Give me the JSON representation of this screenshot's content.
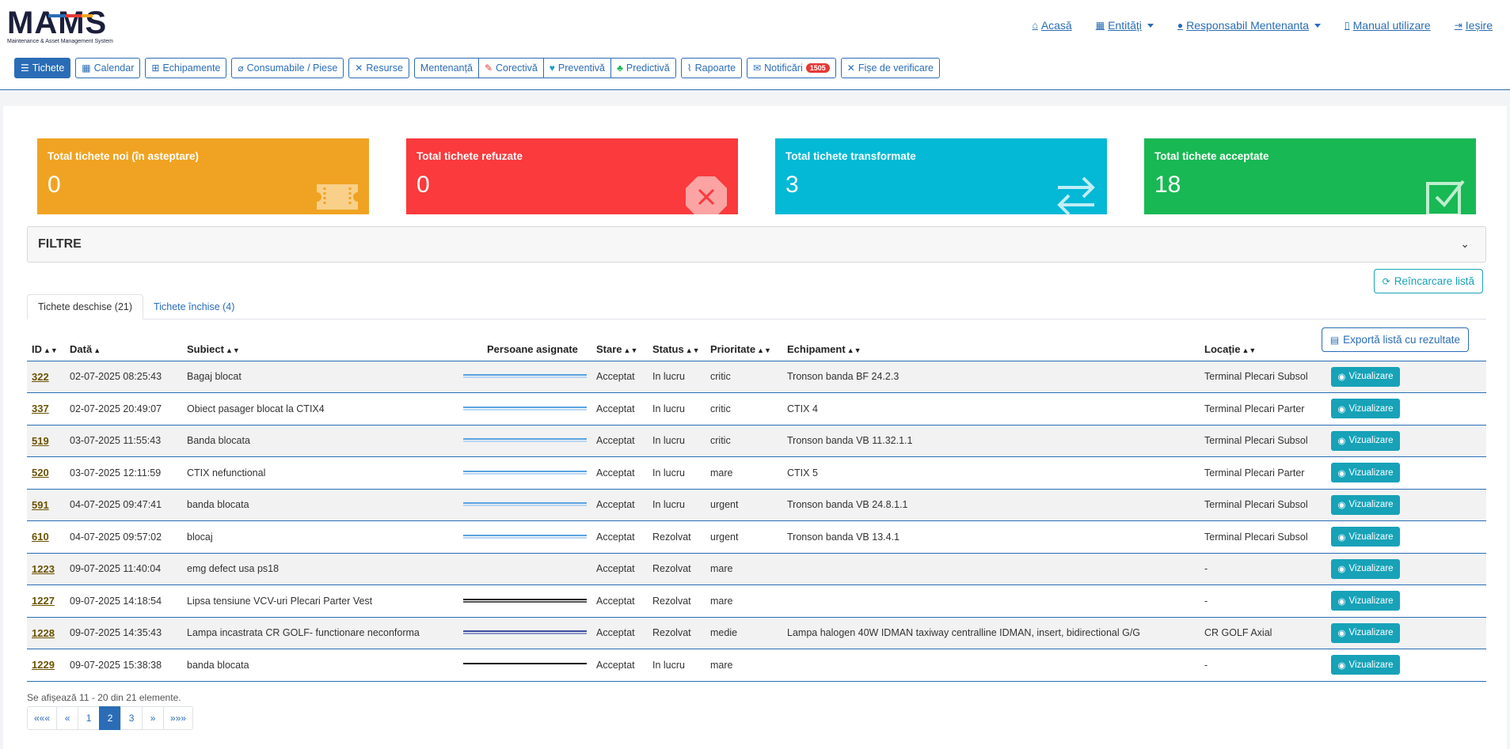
{
  "app": {
    "logo_text": "MAMS",
    "logo_subtitle": "Maintenance & Asset Management System"
  },
  "topnav": [
    {
      "label": "Acasă",
      "icon": "home-icon"
    },
    {
      "label": "Entități",
      "icon": "table-icon",
      "dropdown": true
    },
    {
      "label": "Responsabil Mentenanta",
      "icon": "user-icon",
      "dropdown": true
    },
    {
      "label": "Manual utilizare",
      "icon": "book-icon"
    },
    {
      "label": "Ieșire",
      "icon": "logout-icon"
    }
  ],
  "menu": {
    "tichete": "Tichete",
    "calendar": "Calendar",
    "echipamente": "Echipamente",
    "consumabile": "Consumabile / Piese",
    "resurse": "Resurse",
    "mentenanta": "Mentenanță",
    "corectiva": "Corectivă",
    "preventiva": "Preventivă",
    "predictiva": "Predictivă",
    "rapoarte": "Rapoarte",
    "notificari": "Notificări",
    "notificari_count": "1505",
    "fise": "Fișe de verificare"
  },
  "cards": [
    {
      "title": "Total tichete noi (în asteptare)",
      "value": "0",
      "color": "#f0a322",
      "icon": "ticket-icon"
    },
    {
      "title": "Total tichete refuzate",
      "value": "0",
      "color": "#fa3a3d",
      "icon": "refused-icon"
    },
    {
      "title": "Total tichete transformate",
      "value": "3",
      "color": "#03b9d6",
      "icon": "transfer-icon"
    },
    {
      "title": "Total tichete acceptate",
      "value": "18",
      "color": "#18b854",
      "icon": "accepted-icon"
    }
  ],
  "filter": {
    "title": "FILTRE"
  },
  "reload_label": "Reîncarcare listă",
  "tabs": {
    "open": "Tichete deschise (21)",
    "closed": "Tichete închise (4)"
  },
  "export_label": "Exportă listă cu rezultate",
  "table": {
    "headers": {
      "id": "ID",
      "data": "Dată",
      "subiect": "Subiect",
      "persoane": "Persoane asignate",
      "stare": "Stare",
      "status": "Status",
      "prioritate": "Prioritate",
      "echipament": "Echipament",
      "locatie": "Locație"
    },
    "action_label": "Vizualizare",
    "rows": [
      {
        "id": "322",
        "data": "02-07-2025 08:25:43",
        "subiect": "Bagaj blocat",
        "stare": "Acceptat",
        "status": "In lucru",
        "prioritate": "critic",
        "echipament": "Tronson banda BF 24.2.3",
        "locatie": "Terminal Plecari Subsol",
        "assign_colors": [
          "#5aa2e0",
          "#b9d6f2"
        ]
      },
      {
        "id": "337",
        "data": "02-07-2025 20:49:07",
        "subiect": "Obiect pasager blocat la CTIX4",
        "stare": "Acceptat",
        "status": "In lucru",
        "prioritate": "critic",
        "echipament": "CTIX 4",
        "locatie": "Terminal Plecari Parter",
        "assign_colors": [
          "#5aa2e0",
          "#b9d6f2"
        ]
      },
      {
        "id": "519",
        "data": "03-07-2025 11:55:43",
        "subiect": "Banda blocata",
        "stare": "Acceptat",
        "status": "In lucru",
        "prioritate": "critic",
        "echipament": "Tronson banda VB 11.32.1.1",
        "locatie": "Terminal Plecari Subsol",
        "assign_colors": [
          "#5aa2e0",
          "#b9d6f2"
        ]
      },
      {
        "id": "520",
        "data": "03-07-2025 12:11:59",
        "subiect": "CTIX nefunctional",
        "stare": "Acceptat",
        "status": "In lucru",
        "prioritate": "mare",
        "echipament": "CTIX 5",
        "locatie": "Terminal Plecari Parter",
        "assign_colors": [
          "#5aa2e0",
          "#b9d6f2"
        ]
      },
      {
        "id": "591",
        "data": "04-07-2025 09:47:41",
        "subiect": "banda blocata",
        "stare": "Acceptat",
        "status": "In lucru",
        "prioritate": "urgent",
        "echipament": "Tronson banda VB 24.8.1.1",
        "locatie": "Terminal Plecari Subsol",
        "assign_colors": [
          "#5aa2e0",
          "#b9d6f2"
        ]
      },
      {
        "id": "610",
        "data": "04-07-2025 09:57:02",
        "subiect": "blocaj",
        "stare": "Acceptat",
        "status": "Rezolvat",
        "prioritate": "urgent",
        "echipament": "Tronson banda VB 13.4.1",
        "locatie": "Terminal Plecari Subsol",
        "assign_colors": [
          "#5aa2e0",
          "#b9d6f2"
        ]
      },
      {
        "id": "1223",
        "data": "09-07-2025 11:40:04",
        "subiect": "emg defect usa ps18",
        "stare": "Acceptat",
        "status": "Rezolvat",
        "prioritate": "mare",
        "echipament": "",
        "locatie": "-",
        "assign_colors": [
          "#f2f2f2"
        ]
      },
      {
        "id": "1227",
        "data": "09-07-2025 14:18:54",
        "subiect": "Lipsa tensiune VCV-uri Plecari Parter Vest",
        "stare": "Acceptat",
        "status": "Rezolvat",
        "prioritate": "mare",
        "echipament": "",
        "locatie": "-",
        "assign_colors": [
          "#111111",
          "#555555"
        ]
      },
      {
        "id": "1228",
        "data": "09-07-2025 14:35:43",
        "subiect": "Lampa incastrata CR GOLF- functionare neconforma",
        "stare": "Acceptat",
        "status": "Rezolvat",
        "prioritate": "medie",
        "echipament": "Lampa halogen 40W IDMAN taxiway centralline IDMAN, insert, bidirectional G/G",
        "locatie": "CR GOLF Axial",
        "assign_colors": [
          "#3a4aa0",
          "#8a94c8"
        ]
      },
      {
        "id": "1229",
        "data": "09-07-2025 15:38:38",
        "subiect": "banda blocata",
        "stare": "Acceptat",
        "status": "In lucru",
        "prioritate": "mare",
        "echipament": "",
        "locatie": "-",
        "assign_colors": [
          "#111111"
        ]
      }
    ]
  },
  "info": "Se afișează 11 - 20 din 21 elemente.",
  "pager": [
    "«««",
    "«",
    "1",
    "2",
    "3",
    "»",
    "»»»"
  ],
  "pager_active": "2"
}
